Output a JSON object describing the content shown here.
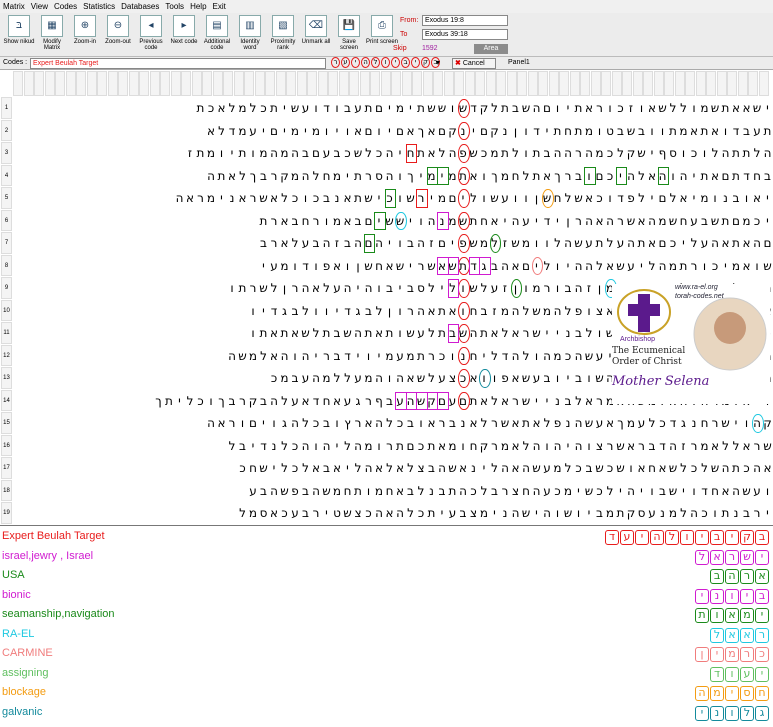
{
  "menu": [
    "Matrix",
    "View",
    "Codes",
    "Statistics",
    "Databases",
    "Tools",
    "Help",
    "Exit"
  ],
  "toolbar": {
    "buttons": [
      "Show nikud",
      "Modify Matrix",
      "Zoom-in",
      "Zoom-out",
      "Previous code",
      "Next code",
      "Additional code",
      "Identity word",
      "Proximity rank",
      "Unmark all",
      "Save screen",
      "Print screen"
    ],
    "from_label": "From:",
    "from_value": "Exodus 19:8",
    "to_label": "To",
    "to_value": "Exodus 39:18",
    "skip_label": "Skip",
    "skip_value": "1592",
    "area_label": "Area"
  },
  "codes_bar": {
    "label": "Codes :",
    "value": "Expert Beulah Target",
    "cancel": "Cancel",
    "panel": "Panel1",
    "code_letters": [
      "ב",
      "ק",
      "י",
      "ב",
      "י",
      "ו",
      "ל",
      "ה",
      "י",
      "ע",
      "ר"
    ]
  },
  "row_numbers": [
    "1",
    "2",
    "3",
    "4",
    "5",
    "6",
    "7",
    "8",
    "9",
    "10",
    "11",
    "12",
    "13",
    "14",
    "15",
    "16",
    "17",
    "18",
    "19"
  ],
  "rows": [
    "ישאאתשמוללשאוזכוראתיוםהשבתלקדשוששתימיםתעבודועשיתכלמלאכת",
    "תעבדואתאמתוובשבטומתחתידוןנקםינקםאךאםיוםאויומימיםיעמדלא",
    "הלתתהלוכוסףישקלכמהרההבתולתמכשפהלאתחיהכלשכבעםבהמהמותיומתז",
    "בחדתםאתיהוהאלהיכםוברךאתלחמךואתמימיךוהסרתימחלהמקרבךלאתה",
    "יאובנומיאלםילפדוכאשלחשןוועשוליםמירשוכישתאנבכוכלאשראנימראה",
    "יכמםתשבעחשמהאשרהאהרןידיעהיאחתשמנהויששיםבאמורחבארת",
    "םהאתאהעליכםאתהעלתעשהלוומשזלמשפיםזהבויהםהבזהבעלארב",
    "שואמיכורתמהליעשאלההיוליםאהבגדתשאשרישאחשןואפודומעי",
    "תתכלאתהעליוםגעפמןזהבורמוןזעלשולילסביבוהיהעלאהרןלשרתו",
    "אגתלחמחמסבשמנוואצופלהמשלהמזבחואתאהרוןלבגדיוולבגדיו",
    "כבתמתחלשבתותויעשולבניישראלאתהשבתלעשותאתהשבתלשאתאתו",
    "הלדליהוהאישאשרייעשהכמהולהדליחנוכרתמעמיוידבריהוהאלמשה",
    "מהחרוםאשמהלהאדמהשוביובעשאפוואכצעלשאהוהמעללמהעבמכ",
    "ויאומרהוהאלמשהאמראלבניישראלאתםעםקשהעבףרגעאחדאעלהבקרבךוכליתך",
    "קהוישרחנגדכלעמךאעשהנפלאתאשרלאנבראובכלהארץובכלהגויםוראה",
    "שראללאמרזהדבראשרצוהיהוהלאמרקחומאתכםתרומהליהוהכלנדיבל",
    "אהכתהשלכלשאחאושכשבכלמעשהאהלינאשהבצלאלאהליאבאלכלישחכ",
    "ועשהאחדוישבויהילכשימכעהחצרבלכהתבנלבאחמותחמשהבפשהבע",
    "ירבנתוכהלמנעסקתמביושוהישהנימצבעיתכלהאהכצשטירבעכאסמל"
  ],
  "legend": [
    {
      "label": "Expert Beulah Target",
      "color": "#e81c1c",
      "word": [
        "ב",
        "ק",
        "י",
        "ב",
        "י",
        "ו",
        "ל",
        "ה",
        "י",
        "ע",
        "ד"
      ]
    },
    {
      "label": "israel,jewry , Israel",
      "color": "#d01bd0",
      "word": [
        "י",
        "ש",
        "ר",
        "א",
        "ל"
      ]
    },
    {
      "label": "USA",
      "color": "#1a8a1a",
      "word": [
        "א",
        "ר",
        "ה",
        "ב"
      ]
    },
    {
      "label": "bionic",
      "color": "#d01bd0",
      "word": [
        "ב",
        "י",
        "ו",
        "נ",
        "י"
      ]
    },
    {
      "label": "seamanship,navigation",
      "color": "#1a8a1a",
      "word": [
        "י",
        "מ",
        "א",
        "ו",
        "ת"
      ]
    },
    {
      "label": "RA-EL",
      "color": "#1ec8e0",
      "word": [
        "ר",
        "א",
        "א",
        "ל"
      ]
    },
    {
      "label": "CARMINE",
      "color": "#f07c7c",
      "word": [
        "כ",
        "ר",
        "מ",
        "י",
        "ן"
      ]
    },
    {
      "label": "assigning",
      "color": "#5fbf5f",
      "word": [
        "י",
        "ע",
        "ו",
        "ד"
      ]
    },
    {
      "label": "blockage",
      "color": "#f39c12",
      "word": [
        "ח",
        "ס",
        "י",
        "מ",
        "ה"
      ]
    },
    {
      "label": "galvanic",
      "color": "#138a9c",
      "word": [
        "ג",
        "ל",
        "ו",
        "נ",
        "י"
      ]
    }
  ],
  "overlay": {
    "url1": "www.ra-el.org",
    "url2": "torah-codes.net",
    "title1": "Archbishop",
    "title2": "The Ecumenical",
    "title3": "Order of Christ",
    "name": "Mother Selena"
  },
  "colors": {
    "red": "#e81c1c",
    "magenta": "#d01bd0",
    "green": "#1a8a1a",
    "cyan": "#1ec8e0",
    "orange": "#f39c12",
    "teal": "#138a9c",
    "pink": "#f07c7c"
  }
}
